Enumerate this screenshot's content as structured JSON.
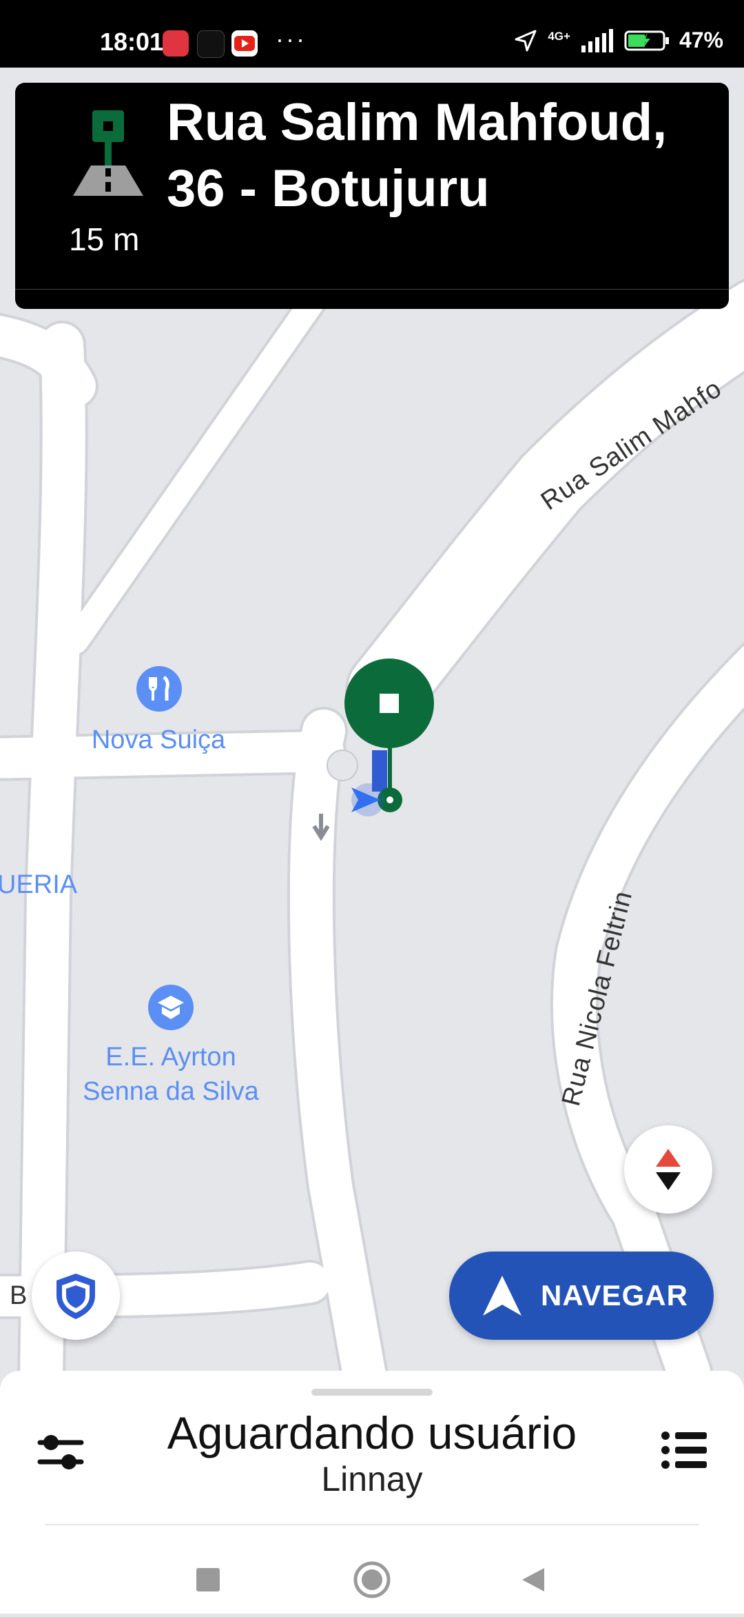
{
  "status_bar": {
    "time": "18:01",
    "apps": [
      "app-icon-red",
      "uber-icon",
      "youtube-icon"
    ],
    "overflow": "···",
    "network": "4G+",
    "battery": "47%"
  },
  "instruction": {
    "distance": "15 m",
    "street": "Rua Salim Mahfoud, 36 - Botujuru",
    "icon": "destination-road-icon"
  },
  "map": {
    "streets": [
      "Rua Salim Mahfo",
      "Rua Nicola Feltrin"
    ],
    "pois": [
      {
        "name": "Nova Suiça",
        "icon": "restaurant-icon"
      },
      {
        "name": "E.E. Ayrton\nSenna da Silva",
        "icon": "school-icon"
      }
    ],
    "partial_labels": [
      "UERIA",
      "B"
    ]
  },
  "buttons": {
    "navigate": "NAVEGAR",
    "compass": "compass-icon",
    "safety": "shield-icon"
  },
  "bottom_sheet": {
    "title": "Aguardando usuário",
    "subtitle": "Linnay"
  },
  "colors": {
    "accent_blue": "#2453b8",
    "route_green": "#0c6b3a",
    "poi_blue": "#5b8ff4",
    "map_bg": "#e5e6ea"
  }
}
